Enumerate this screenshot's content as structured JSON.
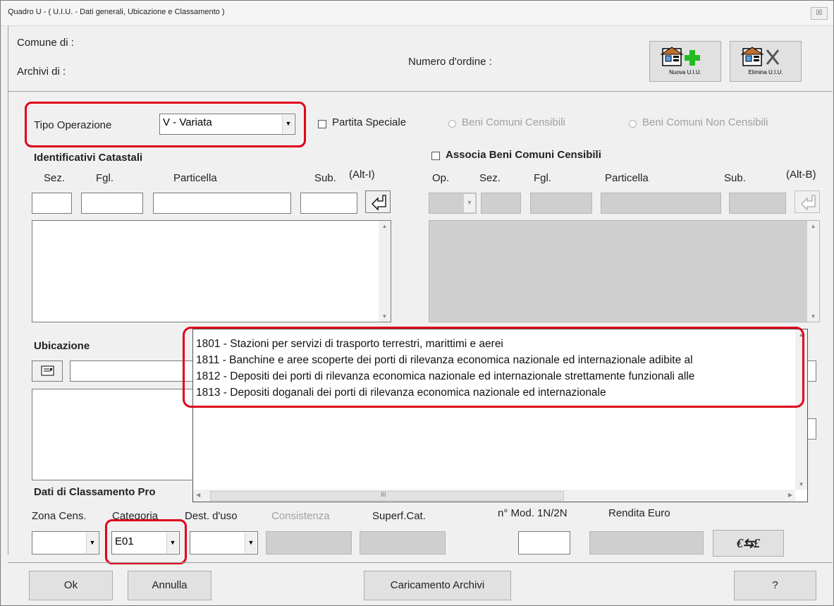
{
  "window": {
    "title": "Quadro U - ( U.I.U. - Dati generali, Ubicazione e Classamento )",
    "close_glyph": "☒"
  },
  "header": {
    "comune_label": "Comune di :",
    "archivi_label": "Archivi di   :",
    "numero_ordine_label": "Numero d'ordine :",
    "nuova_btn": "Nuova U.I.U.",
    "elimina_btn": "Elimina U.I.U."
  },
  "operazione": {
    "tipo_label": "Tipo Operazione",
    "tipo_value": "V - Variata",
    "partita_speciale": "Partita Speciale",
    "beni_censibili": "Beni Comuni Censibili",
    "beni_non_censibili": "Beni Comuni Non Censibili"
  },
  "identificativi": {
    "title": "Identificativi Catastali",
    "sez": "Sez.",
    "fgl": "Fgl.",
    "particella": "Particella",
    "sub": "Sub.",
    "alt": "(Alt-I)"
  },
  "associa": {
    "title": "Associa Beni Comuni Censibili",
    "op": "Op.",
    "sez": "Sez.",
    "fgl": "Fgl.",
    "particella": "Particella",
    "sub": "Sub.",
    "alt": "(Alt-B)"
  },
  "ubicazione": {
    "title": "Ubicazione"
  },
  "categoria_list": {
    "items": [
      "1801 - Stazioni per servizi di trasporto terrestri, marittimi e aerei",
      "1811 - Banchine e aree scoperte dei porti di rilevanza economica nazionale ed internazionale adibite al",
      "1812 - Depositi dei porti di rilevanza economica nazionale ed internazionale strettamente funzionali alle",
      "1813 - Depositi doganali dei porti di rilevanza economica nazionale ed internazionale"
    ],
    "hscroll_grip": "III"
  },
  "classamento": {
    "title": "Dati di Classamento Pro",
    "zona": "Zona Cens.",
    "categoria": "Categoria",
    "dest": "Dest. d'uso",
    "consistenza": "Consistenza",
    "superf": "Superf.Cat.",
    "nmod": "n° Mod. 1N/2N",
    "rendita": "Rendita  Euro",
    "categoria_value": "E01",
    "currency_btn": "€⇆£"
  },
  "footer": {
    "ok": "Ok",
    "annulla": "Annulla",
    "caricamento": "Caricamento Archivi",
    "help": "?"
  },
  "colors": {
    "highlight": "#e0001a",
    "disabled": "#cfcfcf"
  }
}
